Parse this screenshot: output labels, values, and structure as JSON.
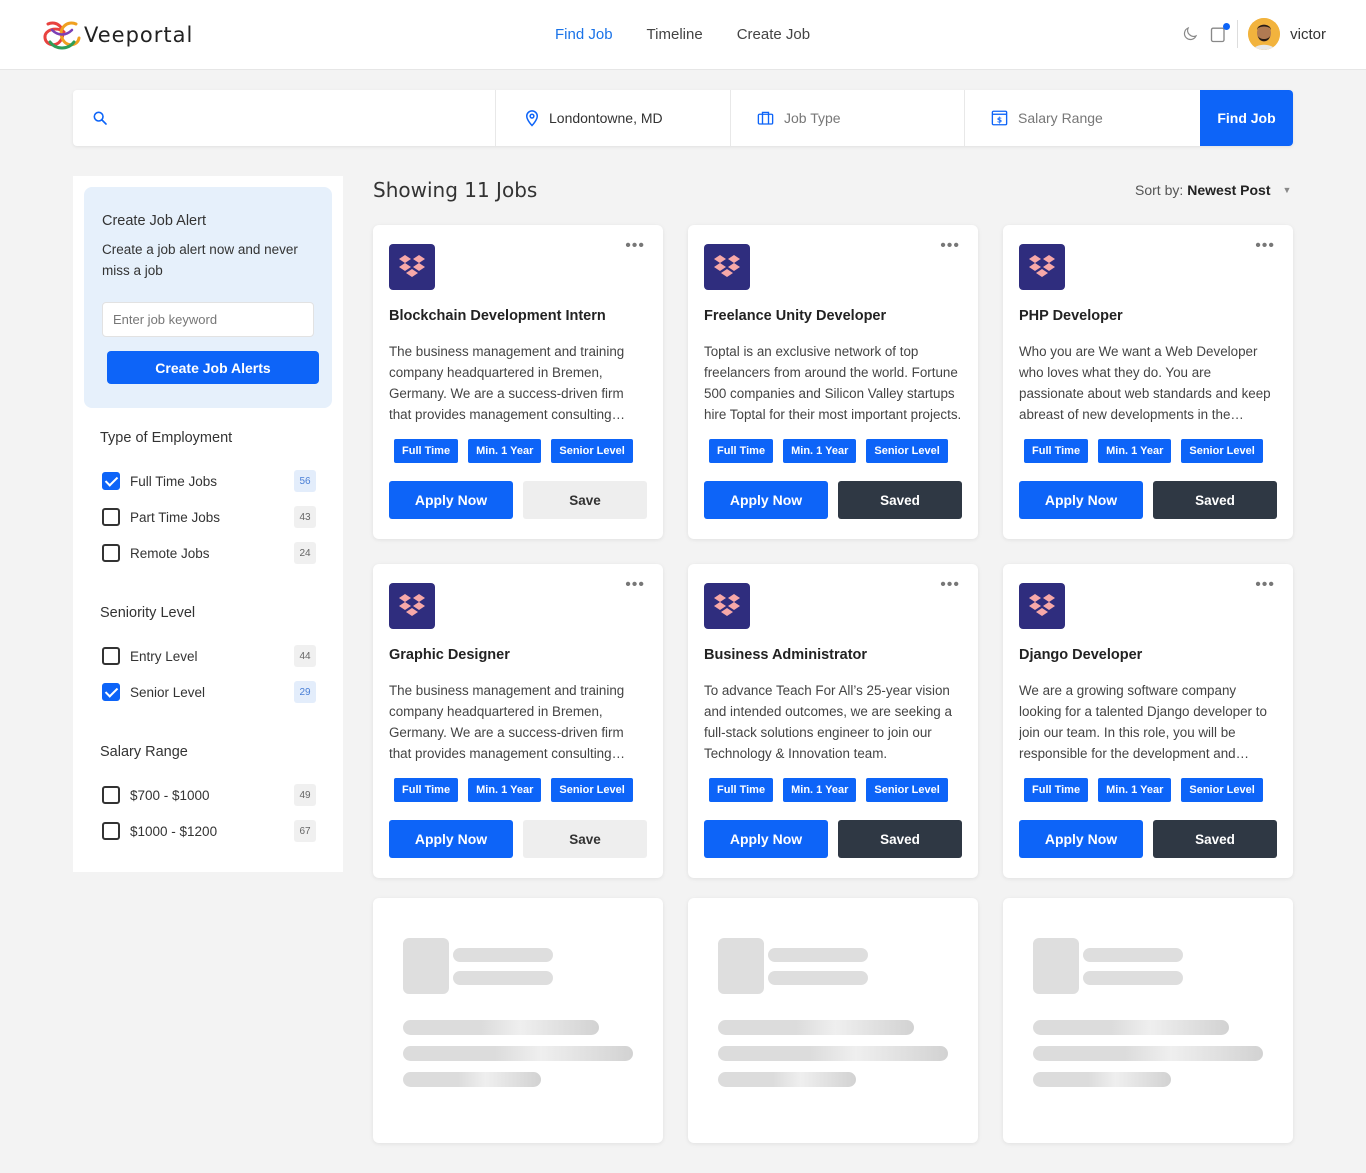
{
  "brand": {
    "name": "Veeportal"
  },
  "nav": {
    "items": [
      "Find Job",
      "Timeline",
      "Create Job"
    ],
    "active": "Find Job"
  },
  "user": {
    "name": "victor"
  },
  "search": {
    "keyword_placeholder": "",
    "location": "Londontowne, MD",
    "job_type_placeholder": "Job Type",
    "salary_placeholder": "Salary Range",
    "button": "Find Job"
  },
  "alert": {
    "title": "Create Job Alert",
    "description": "Create a job alert now and never miss a job",
    "input_placeholder": "Enter job keyword",
    "button": "Create Job Alerts"
  },
  "filters": {
    "employment": {
      "title": "Type of Employment",
      "items": [
        {
          "label": "Full Time Jobs",
          "count": "56",
          "checked": true
        },
        {
          "label": "Part Time Jobs",
          "count": "43",
          "checked": false
        },
        {
          "label": "Remote Jobs",
          "count": "24",
          "checked": false
        }
      ]
    },
    "seniority": {
      "title": "Seniority Level",
      "items": [
        {
          "label": "Entry Level",
          "count": "44",
          "checked": false
        },
        {
          "label": "Senior Level",
          "count": "29",
          "checked": true
        }
      ]
    },
    "salary": {
      "title": "Salary Range",
      "items": [
        {
          "label": "$700 - $1000",
          "count": "49",
          "checked": false
        },
        {
          "label": "$1000 - $1200",
          "count": "67",
          "checked": false
        }
      ]
    }
  },
  "results": {
    "heading": "Showing 11 Jobs",
    "sort_label": "Sort by:",
    "sort_value": "Newest Post"
  },
  "jobs": [
    {
      "title": "Blockchain Development Intern",
      "description": "The business management and training company headquartered in Bremen, Germany. We are a success-driven firm that provides management consulting services.",
      "tags": [
        "Full Time",
        "Min. 1 Year",
        "Senior Level"
      ],
      "apply_label": "Apply Now",
      "save_label": "Save",
      "saved": false
    },
    {
      "title": "Freelance Unity Developer",
      "description": "Toptal is an exclusive network of top freelancers from around the world. Fortune 500 companies and Silicon Valley startups hire Toptal for their most important projects.",
      "tags": [
        "Full Time",
        "Min. 1 Year",
        "Senior Level"
      ],
      "apply_label": "Apply Now",
      "save_label": "Saved",
      "saved": true
    },
    {
      "title": "PHP Developer",
      "description": "Who you are We want a Web Developer who loves what they do. You are passionate about web standards and keep abreast of new developments in the industry.",
      "tags": [
        "Full Time",
        "Min. 1 Year",
        "Senior Level"
      ],
      "apply_label": "Apply Now",
      "save_label": "Saved",
      "saved": true
    },
    {
      "title": "Graphic Designer",
      "description": "The business management and training company headquartered in Bremen, Germany. We are a success-driven firm that provides management consulting services.",
      "tags": [
        "Full Time",
        "Min. 1 Year",
        "Senior Level"
      ],
      "apply_label": "Apply Now",
      "save_label": "Save",
      "saved": false
    },
    {
      "title": "Business Administrator",
      "description": "To advance Teach For All’s 25-year vision and intended outcomes, we are seeking a full-stack solutions engineer to join our Technology & Innovation team.",
      "tags": [
        "Full Time",
        "Min. 1 Year",
        "Senior Level"
      ],
      "apply_label": "Apply Now",
      "save_label": "Saved",
      "saved": true
    },
    {
      "title": "Django Developer",
      "description": "We are a growing software company looking for a talented Django developer to join our team. In this role, you will be responsible for the development and maintenance of our web applications.",
      "tags": [
        "Full Time",
        "Min. 1 Year",
        "Senior Level"
      ],
      "apply_label": "Apply Now",
      "save_label": "Saved",
      "saved": true
    }
  ],
  "colors": {
    "primary": "#0d64f8",
    "saved_button": "#2f3844",
    "company_logo_bg": "#2f2d7e",
    "company_logo_fg": "#f7a8a8",
    "alert_bg": "#e6f0fb"
  }
}
